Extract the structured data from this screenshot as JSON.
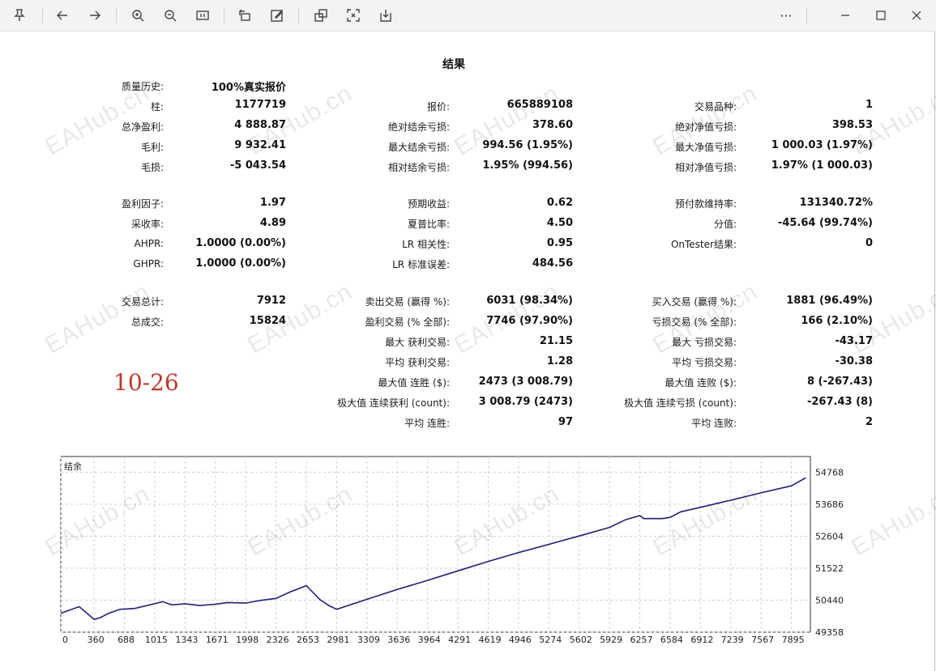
{
  "toolbar": {
    "icons": [
      "pin-icon",
      "back-icon",
      "forward-icon",
      "zoom-in-icon",
      "zoom-out-icon",
      "fit-page-icon",
      "rotate-icon",
      "edit-icon",
      "copy-icon",
      "fullscreen-icon",
      "save-icon"
    ],
    "more_label": "···"
  },
  "report": {
    "title": "结果",
    "stamp": "10-26",
    "watermark": "EAHub.cn",
    "col1": [
      {
        "label": "质量历史:",
        "value": "100%真实报价"
      },
      {
        "label": "柱:",
        "value": "1177719"
      },
      {
        "label": "总净盈利:",
        "value": "4 888.87"
      },
      {
        "label": "毛利:",
        "value": "9 932.41"
      },
      {
        "label": "毛损:",
        "value": "-5 043.54"
      },
      {
        "label": "盈利因子:",
        "value": "1.97"
      },
      {
        "label": "采收率:",
        "value": "4.89"
      },
      {
        "label": "AHPR:",
        "value": "1.0000 (0.00%)"
      },
      {
        "label": "GHPR:",
        "value": "1.0000 (0.00%)"
      },
      {
        "label": "交易总计:",
        "value": "7912"
      },
      {
        "label": "总成交:",
        "value": "15824"
      }
    ],
    "col2": [
      {
        "label": "报价:",
        "value": "665889108"
      },
      {
        "label": "绝对结余亏损:",
        "value": "378.60"
      },
      {
        "label": "最大结余亏损:",
        "value": "994.56 (1.95%)"
      },
      {
        "label": "相对结余亏损:",
        "value": "1.95% (994.56)"
      },
      {
        "label": "预期收益:",
        "value": "0.62"
      },
      {
        "label": "夏普比率:",
        "value": "4.50"
      },
      {
        "label": "LR 相关性:",
        "value": "0.95"
      },
      {
        "label": "LR 标准误差:",
        "value": "484.56"
      },
      {
        "label": "卖出交易 (赢得 %):",
        "value": "6031 (98.34%)"
      },
      {
        "label": "盈利交易 (% 全部):",
        "value": "7746 (97.90%)"
      },
      {
        "label": "最大 获利交易:",
        "value": "21.15"
      },
      {
        "label": "平均 获利交易:",
        "value": "1.28"
      },
      {
        "label": "最大值 连胜 ($):",
        "value": "2473 (3 008.79)"
      },
      {
        "label": "极大值 连续获利 (count):",
        "value": "3 008.79 (2473)"
      },
      {
        "label": "平均 连胜:",
        "value": "97"
      }
    ],
    "col3": [
      {
        "label": "交易品种:",
        "value": "1"
      },
      {
        "label": "绝对净值亏损:",
        "value": "398.53"
      },
      {
        "label": "最大净值亏损:",
        "value": "1 000.03 (1.97%)"
      },
      {
        "label": "相对净值亏损:",
        "value": "1.97% (1 000.03)"
      },
      {
        "label": "预付款维持率:",
        "value": "131340.72%"
      },
      {
        "label": "分值:",
        "value": "-45.64 (99.74%)"
      },
      {
        "label": "OnTester结果:",
        "value": "0"
      },
      {
        "label": "买入交易 (赢得 %):",
        "value": "1881 (96.49%)"
      },
      {
        "label": "亏损交易 (% 全部):",
        "value": "166 (2.10%)"
      },
      {
        "label": "最大 亏损交易:",
        "value": "-43.17"
      },
      {
        "label": "平均 亏损交易:",
        "value": "-30.38"
      },
      {
        "label": "最大值 连败 ($):",
        "value": "8 (-267.43)"
      },
      {
        "label": "极大值 连续亏损 (count):",
        "value": "-267.43 (8)"
      },
      {
        "label": "平均 连败:",
        "value": "2"
      }
    ]
  },
  "chart_data": {
    "type": "line",
    "title": "结余",
    "line_color": "#1f1f7a",
    "grid": true,
    "x_ticks": [
      "0",
      "360",
      "688",
      "1015",
      "1343",
      "1671",
      "1998",
      "2326",
      "2653",
      "2981",
      "3309",
      "3636",
      "3964",
      "4291",
      "4619",
      "4946",
      "5274",
      "5602",
      "5929",
      "6257",
      "6584",
      "6912",
      "7239",
      "7567",
      "7895"
    ],
    "y_ticks": [
      "54768",
      "53686",
      "52604",
      "51522",
      "50440",
      "49358"
    ],
    "xlim": [
      0,
      8100
    ],
    "ylim": [
      49358,
      55300
    ],
    "series": [
      {
        "x": [
          0,
          200,
          360,
          420,
          520,
          640,
          800,
          1015,
          1100,
          1200,
          1343,
          1500,
          1671,
          1800,
          1998,
          2150,
          2326,
          2480,
          2653,
          2720,
          2800,
          2900,
          2981,
          3309,
          3636,
          3964,
          4291,
          4619,
          4946,
          5274,
          5602,
          5929,
          6100,
          6257,
          6300,
          6500,
          6584,
          6700,
          6912,
          7239,
          7567,
          7895,
          8050
        ],
        "y": [
          50000,
          50220,
          49790,
          49840,
          50000,
          50130,
          50160,
          50320,
          50390,
          50280,
          50320,
          50260,
          50300,
          50360,
          50340,
          50430,
          50500,
          50720,
          50930,
          50720,
          50460,
          50250,
          50130,
          50470,
          50800,
          51110,
          51430,
          51750,
          52050,
          52330,
          52610,
          52900,
          53160,
          53300,
          53200,
          53200,
          53240,
          53430,
          53580,
          53820,
          54070,
          54310,
          54580
        ]
      }
    ]
  }
}
